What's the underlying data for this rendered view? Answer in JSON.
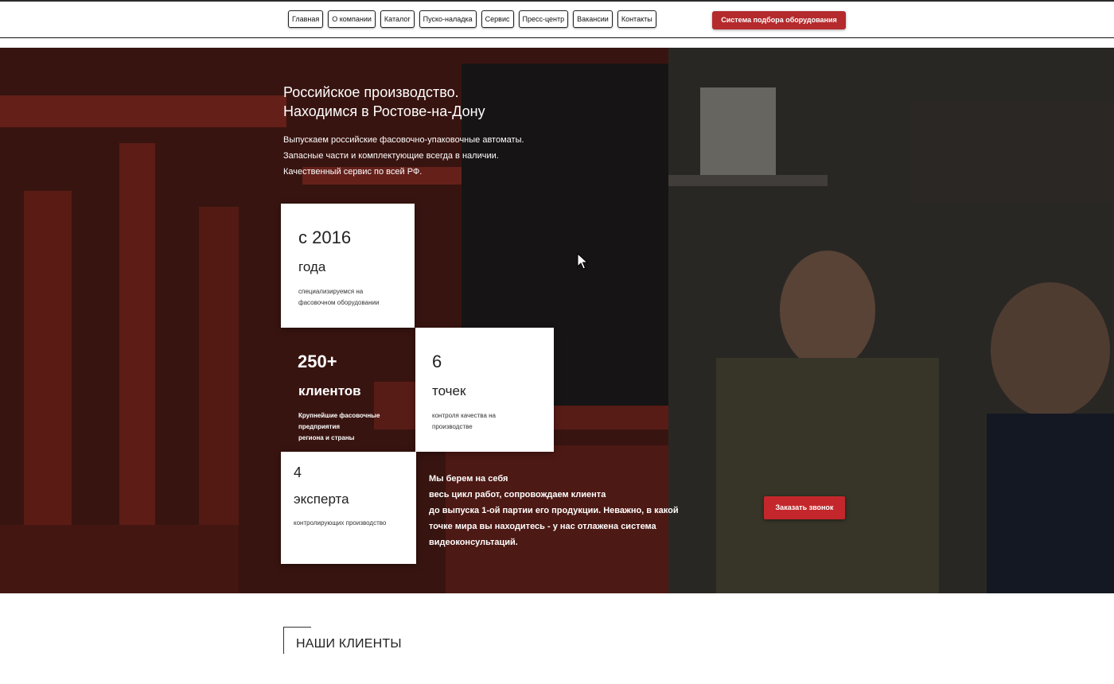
{
  "nav": {
    "items": [
      "Главная",
      "О компании",
      "Каталог",
      "Пуско-наладка",
      "Сервис",
      "Пресс-центр",
      "Вакансии",
      "Контакты"
    ],
    "select_button": "Система подбора оборудования"
  },
  "hero": {
    "title_lines": [
      "Российское производство.",
      "Находимся в Ростове-на-Дону"
    ],
    "desc_lines": [
      "Выпускаем российские фасовочно-упаковочные автоматы.",
      "Запасные части и комплектующие всегда в наличии.",
      "Качественный сервис по всей РФ."
    ],
    "stats": {
      "since": {
        "big": "с 2016",
        "mid": "года",
        "small": [
          "специализируемся на",
          "фасовочном оборудовании"
        ]
      },
      "clients": {
        "big": "250+",
        "mid": "клиентов",
        "small": [
          "Крупнейшие фасовочные предприятия",
          "региона и страны"
        ]
      },
      "points": {
        "big": "6",
        "mid": "точек",
        "small": [
          "контроля качества на",
          "производстве"
        ]
      },
      "experts": {
        "big": "4",
        "mid": "эксперта",
        "small": [
          "контролирующих производство"
        ]
      }
    },
    "text_lines": [
      "Мы берем на себя",
      "весь цикл работ, сопровождаем клиента",
      "до выпуска 1-ой партии его продукции. Неважно, в какой",
      "точке мира вы находитесь - у нас отлажена система",
      "видеоконсультаций."
    ],
    "call_button": "Заказать звонок"
  },
  "clients_section": {
    "title": "НАШИ КЛИЕНТЫ"
  }
}
